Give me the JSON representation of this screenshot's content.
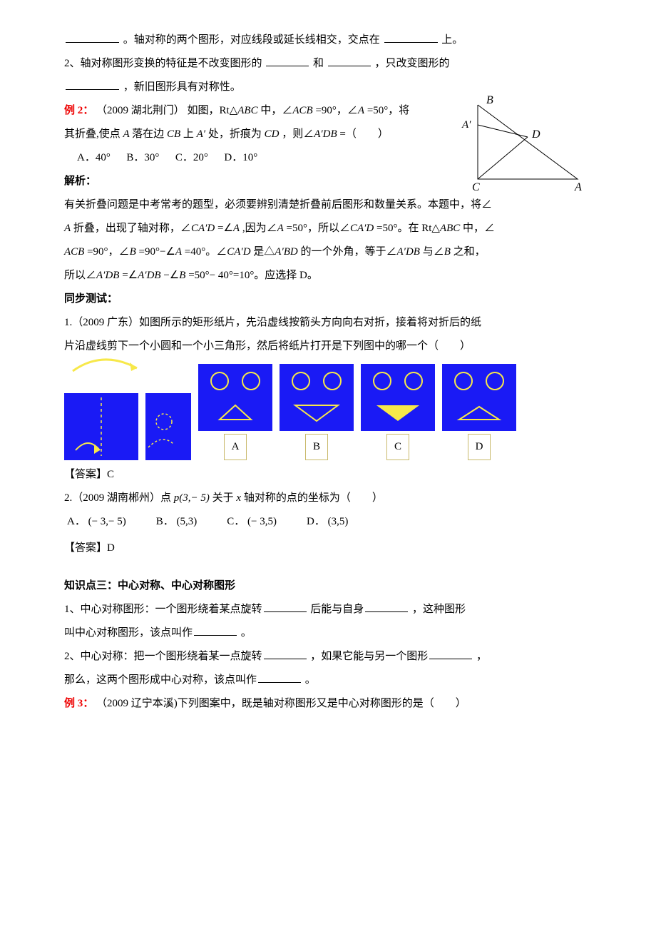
{
  "intro": {
    "line1_before": "",
    "line1_mid": " 。轴对称的两个图形，对应线段或延长线相交，交点在",
    "line1_after": "上。",
    "line2_before": "2、轴对称图形变换的特征是不改变图形的",
    "line2_mid": "和",
    "line2_after": " ，只改变图形的",
    "line3_after": " ，新旧图形具有对称性。"
  },
  "ex2": {
    "label": "例 2：",
    "source": "（2009 湖北荆门）",
    "body1": "如图，Rt△",
    "abc": "ABC",
    "body2": " 中，∠",
    "acb": "ACB",
    "body3": "=90°，∠",
    "aEq": "A",
    "body4": "=50°，将",
    "body5": "其折叠,使点 ",
    "aPt": "A ",
    "body6": "落在边 ",
    "cb": "CB ",
    "body7": "上 ",
    "aPrime": "A′",
    "body8": " 处，折痕为 ",
    "cd": "CD",
    "body9": "，则∠",
    "adb": "A′DB",
    "body10": " =（　　）",
    "choices": {
      "a": "A．40°",
      "b": "B．30°",
      "c": "C．20°",
      "d": "D．10°"
    }
  },
  "triangle": {
    "B": "B",
    "Ap": "A′",
    "D": "D",
    "C": "C",
    "A": "A"
  },
  "analysis": {
    "label": "解析：",
    "p1a": "有关折叠问题是中考常考的题型，必须要辨别清楚折叠前后图形和数量关系。本题中，将∠",
    "p1b": " 折叠，出现了轴对称，∠",
    "caD": "CA′D",
    "p1c": "=∠",
    "p1d": ",因为∠",
    "p1e": "=50°，所以∠",
    "p1f": "=50°。在 Rt△",
    "p1g": " 中，∠",
    "p2a": "=90°，∠",
    "bEq": "B",
    "p2b": "=90°−∠",
    "p2c": "=40°。∠",
    "p2d": " 是△",
    "aBD": "A′BD",
    "p2e": " 的一个外角，等于∠",
    "aDB": "A′DB",
    "p2f": " 与∠",
    "p2g": " 之和，",
    "p3a": "所以∠",
    "p3b": "=∠",
    "p3c": " −∠",
    "p3d": "=50°− 40°=10°。应选择 D。"
  },
  "sync": {
    "label": "同步测试：",
    "q1a": "1.（2009 广东）如图所示的矩形纸片，先沿虚线按箭头方向向右对折，接着将对折后的纸",
    "q1b": "片沿虚线剪下一个小圆和一个小三角形，然后将纸片打开是下列图中的哪一个（　　）",
    "figLabels": {
      "A": "A",
      "B": "B",
      "C": "C",
      "D": "D"
    },
    "ans1": "【答案】C",
    "q2_before": "2.（2009 湖南郴州）点 ",
    "q2_p": "p(3,− 5)",
    "q2_mid": "关于 ",
    "q2_x": "x",
    "q2_after": " 轴对称的点的坐标为（　　）",
    "q2_choices": {
      "A_lab": "A．",
      "A_val": "(− 3,− 5)",
      "B_lab": "B．",
      "B_val": "(5,3)",
      "C_lab": "C．",
      "C_val": "(− 3,5)",
      "D_lab": "D．",
      "D_val": "(3,5)"
    },
    "ans2": "【答案】D"
  },
  "kp3": {
    "title": "知识点三：中心对称、中心对称图形",
    "l1a": "1、中心对称图形：一个图形绕着某点旋转",
    "l1b": " 后能与自身",
    "l1c": " ，这种图形",
    "l1d": "叫中心对称图形，该点叫作",
    "l1e": " 。",
    "l2a": "2、中心对称：把一个图形绕着某一点旋转",
    "l2b": " ，如果它能与另一个图形",
    "l2c": " ，",
    "l2d": "那么，这两个图形成中心对称，该点叫作",
    "l2e": " 。"
  },
  "ex3": {
    "label": "例 3：",
    "body": "（2009 辽宁本溪)下列图案中，既是轴对称图形又是中心对称图形的是（　　）"
  }
}
